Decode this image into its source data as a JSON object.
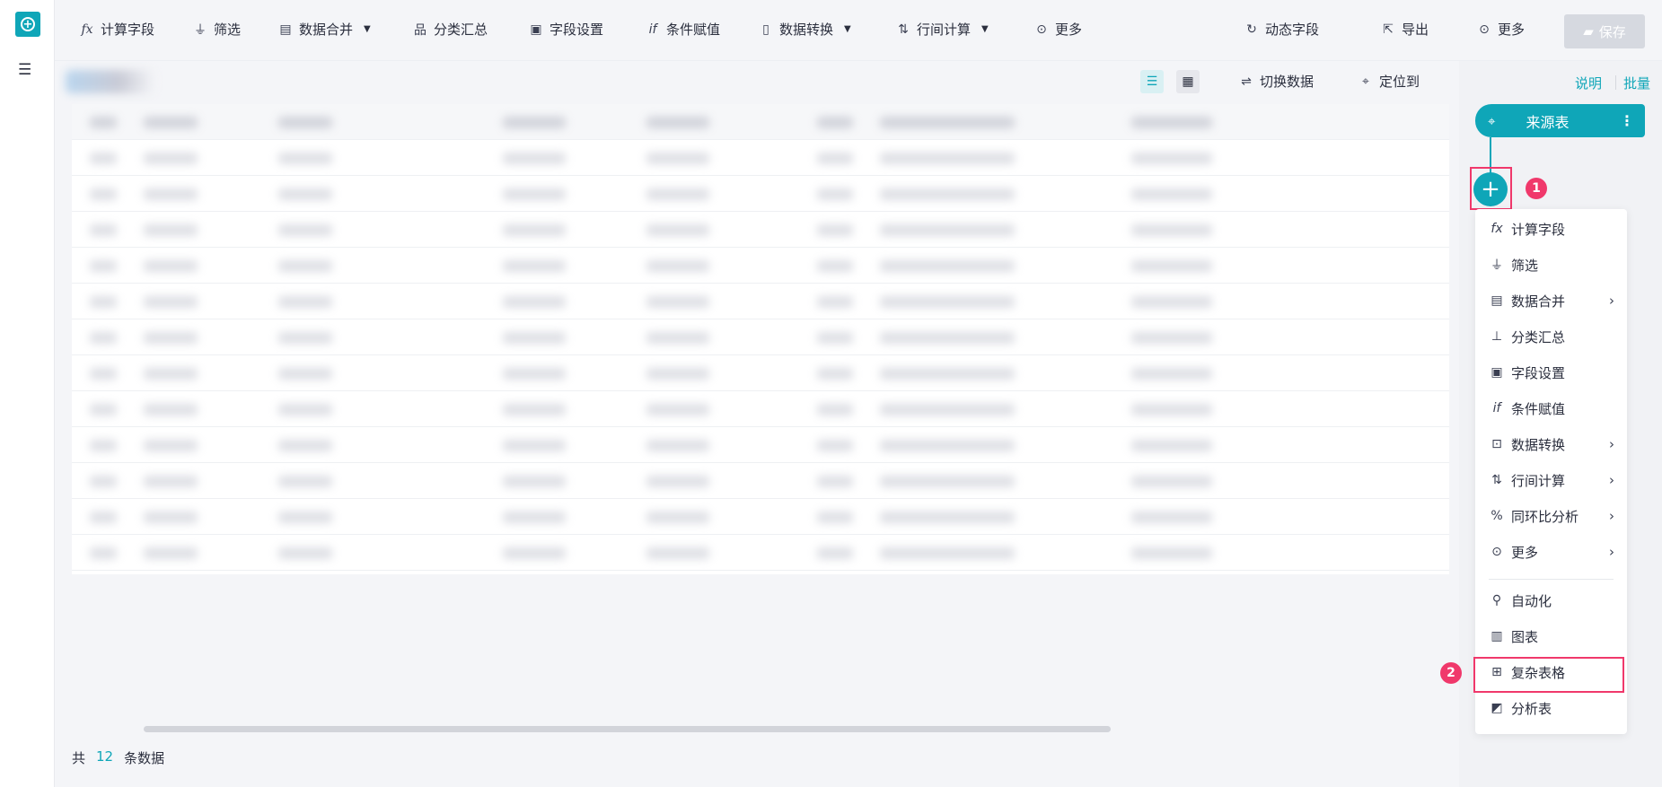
{
  "toolbar": {
    "items": [
      {
        "icon": "fx-icon",
        "label": "计算字段"
      },
      {
        "icon": "filter-icon",
        "label": "筛选"
      },
      {
        "icon": "merge-icon",
        "label": "数据合并",
        "dropdown": true
      },
      {
        "icon": "group-summary-icon",
        "label": "分类汇总"
      },
      {
        "icon": "field-settings-icon",
        "label": "字段设置"
      },
      {
        "icon": "if-icon",
        "label": "条件赋值"
      },
      {
        "icon": "transform-icon",
        "label": "数据转换",
        "dropdown": true
      },
      {
        "icon": "row-calc-icon",
        "label": "行间计算",
        "dropdown": true
      },
      {
        "icon": "more-icon",
        "label": "更多"
      }
    ],
    "right": {
      "dynamic_field": "动态字段",
      "export": "导出",
      "more": "更多",
      "save": "保存"
    }
  },
  "subbar": {
    "switch_data": "切换数据",
    "locate": "定位到"
  },
  "right_panel": {
    "explain": "说明",
    "batch": "批量",
    "source_node": "来源表",
    "step1": "1",
    "step2": "2",
    "menu": [
      {
        "icon": "fx-icon",
        "label": "计算字段"
      },
      {
        "icon": "filter-icon",
        "label": "筛选"
      },
      {
        "icon": "merge-icon",
        "label": "数据合并",
        "submenu": true
      },
      {
        "icon": "group-summary-icon",
        "label": "分类汇总"
      },
      {
        "icon": "field-settings-icon",
        "label": "字段设置"
      },
      {
        "icon": "if-icon",
        "label": "条件赋值"
      },
      {
        "icon": "transform-icon",
        "label": "数据转换",
        "submenu": true
      },
      {
        "icon": "row-calc-icon",
        "label": "行间计算",
        "submenu": true
      },
      {
        "icon": "yoy-icon",
        "label": "同环比分析",
        "submenu": true
      },
      {
        "icon": "more-icon",
        "label": "更多",
        "submenu": true
      },
      {
        "icon": "automation-icon",
        "label": "自动化"
      },
      {
        "icon": "chart-icon",
        "label": "图表"
      },
      {
        "icon": "complex-table-icon",
        "label": "复杂表格",
        "highlighted": true
      },
      {
        "icon": "analysis-table-icon",
        "label": "分析表"
      }
    ]
  },
  "footer": {
    "prefix": "共",
    "count": "12",
    "suffix": "条数据"
  },
  "colors": {
    "accent": "#0fa6b8",
    "highlight": "#f0386b",
    "save_disabled": "#d6d9e0"
  }
}
